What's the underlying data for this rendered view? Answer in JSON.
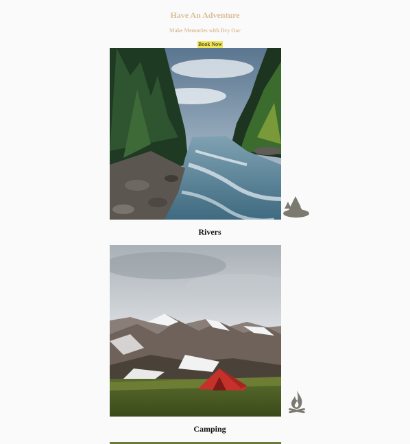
{
  "hero": {
    "title": "Have An Adventure",
    "subtitle": "Make Memories with Dry Oar",
    "book_label": "Book Now"
  },
  "colors": {
    "heading": "#dcbf9a",
    "button_bg": "#f1e55a",
    "icon": "#7a7a70"
  },
  "cards": [
    {
      "caption": "Rivers",
      "icon": "forest-icon",
      "image": "river-photo"
    },
    {
      "caption": "Camping",
      "icon": "campfire-icon",
      "image": "camping-photo"
    }
  ]
}
